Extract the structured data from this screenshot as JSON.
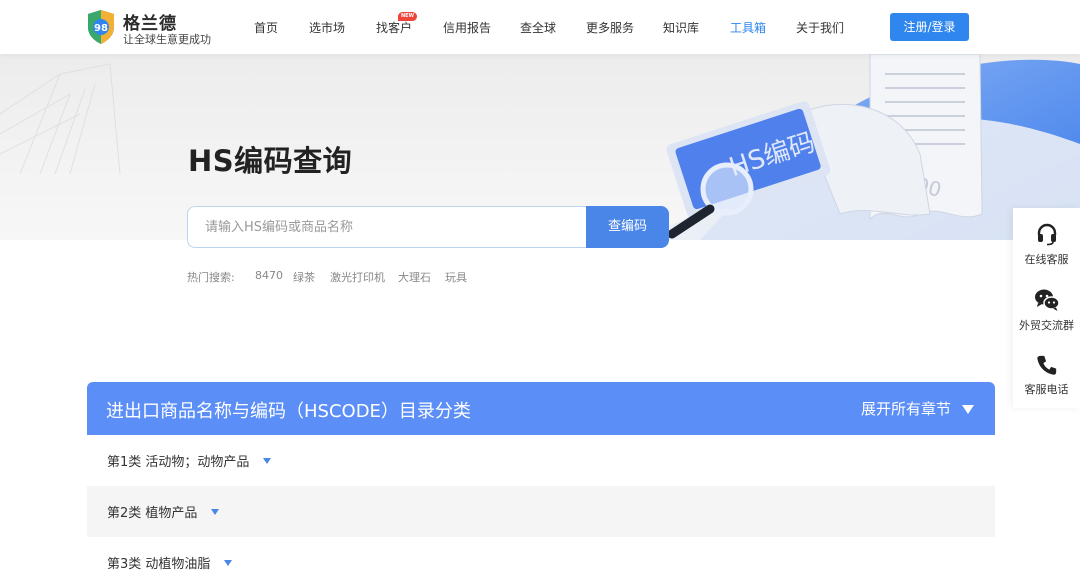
{
  "brand": {
    "name": "格兰德",
    "slogan": "让全球生意更成功",
    "logo_text": "98"
  },
  "nav": [
    {
      "label": "首页"
    },
    {
      "label": "选市场"
    },
    {
      "label": "找客户",
      "badge": "NEW"
    },
    {
      "label": "信用报告"
    },
    {
      "label": "查全球"
    },
    {
      "label": "更多服务"
    },
    {
      "label": "知识库"
    },
    {
      "label": "工具箱",
      "active": true
    },
    {
      "label": "关于我们"
    }
  ],
  "login_label": "注册/登录",
  "hero": {
    "title": "HS编码查询",
    "search_placeholder": "请输入HS编码或商品名称",
    "search_button": "查编码",
    "hot_label": "热门搜索:",
    "hot_items": [
      "8470",
      "绿茶",
      "激光打印机",
      "大理石",
      "玩具"
    ],
    "art_text": {
      "binary": "0100",
      "hs": "HS编码"
    }
  },
  "side_panel": [
    {
      "label": "在线客服",
      "icon": "headset-icon"
    },
    {
      "label": "外贸交流群",
      "icon": "wechat-icon"
    },
    {
      "label": "客服电话",
      "icon": "phone-icon"
    }
  ],
  "directory": {
    "title": "进出口商品名称与编码（HSCODE）目录分类",
    "expand_label": "展开所有章节",
    "categories": [
      {
        "label": "第1类 活动物；动物产品"
      },
      {
        "label": "第2类 植物产品"
      },
      {
        "label": "第3类 动植物油脂"
      }
    ]
  },
  "colors": {
    "accent": "#2f86ee",
    "directory_header": "#5b8ef6",
    "search_button": "#4a86e8"
  }
}
